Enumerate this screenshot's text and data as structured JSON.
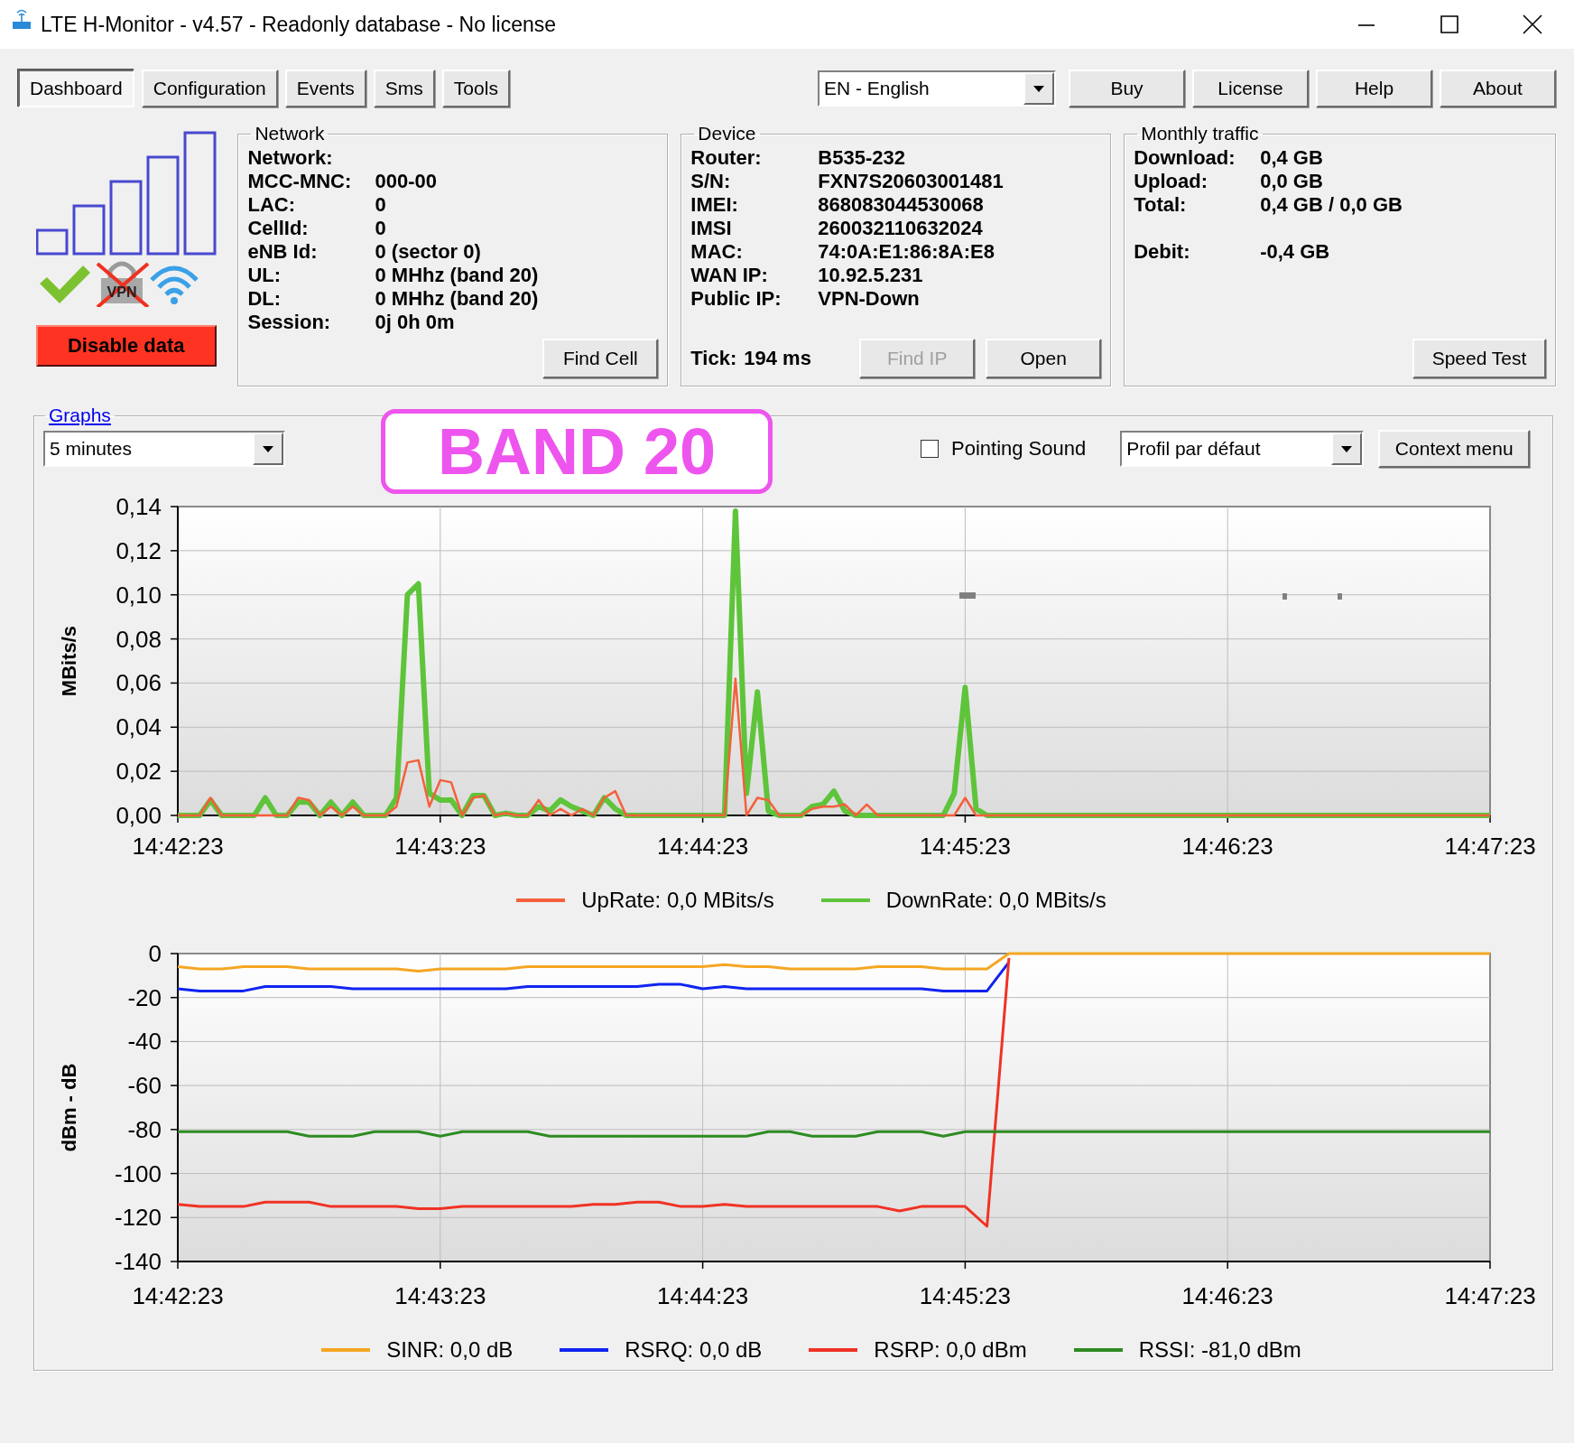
{
  "window": {
    "title": "LTE H-Monitor - v4.57 - Readonly database - No license"
  },
  "tabs": [
    {
      "label": "Dashboard",
      "selected": true
    },
    {
      "label": "Configuration",
      "selected": false
    },
    {
      "label": "Events",
      "selected": false
    },
    {
      "label": "Sms",
      "selected": false
    },
    {
      "label": "Tools",
      "selected": false
    }
  ],
  "language": {
    "value": "EN - English"
  },
  "top_buttons": [
    "Buy",
    "License",
    "Help",
    "About"
  ],
  "status": {
    "connected": true,
    "vpn": false,
    "vpn_label": "VPN",
    "disable_data_button": "Disable data"
  },
  "network": {
    "title": "Network",
    "rows": [
      {
        "label": "Network:"
      },
      {
        "label": "MCC-MNC:",
        "value": "000-00"
      },
      {
        "label": "LAC:",
        "value": "0"
      },
      {
        "label": "CellId:",
        "value": "0"
      },
      {
        "label": "eNB Id:",
        "value": "0 (sector 0)"
      },
      {
        "label": "UL:",
        "value": "0 MHhz (band 20)"
      },
      {
        "label": "DL:",
        "value": "0 MHhz (band 20)"
      },
      {
        "label": "Session:",
        "value": "0j 0h 0m"
      }
    ],
    "find_cell_button": "Find Cell"
  },
  "device": {
    "title": "Device",
    "rows": [
      {
        "label": "Router:",
        "value": "B535-232"
      },
      {
        "label": "S/N:",
        "value": "FXN7S20603001481"
      },
      {
        "label": "IMEI:",
        "value": "868083044530068"
      },
      {
        "label": "IMSI",
        "value": "260032110632024"
      },
      {
        "label": "MAC:",
        "value": "74:0A:E1:86:8A:E8"
      },
      {
        "label": "WAN IP:",
        "value": "10.92.5.231"
      },
      {
        "label": "Public IP:",
        "value": "VPN-Down"
      }
    ],
    "tick": {
      "label": "Tick:",
      "value": "194 ms"
    },
    "buttons": [
      {
        "label": "Find IP",
        "disabled": true
      },
      {
        "label": "Open",
        "disabled": false
      }
    ]
  },
  "monthly_traffic": {
    "title": "Monthly traffic",
    "rows": [
      {
        "label": "Download:",
        "value": "0,4 GB"
      },
      {
        "label": "Upload:",
        "value": "0,0 GB"
      },
      {
        "label": "Total:",
        "value": "0,4 GB / 0,0 GB"
      }
    ],
    "balance": {
      "label": "Debit:",
      "value": "-0,4 GB"
    },
    "speed_test_button": "Speed Test"
  },
  "graphs": {
    "title": "Graphs",
    "period": {
      "value": "5 minutes"
    },
    "band_badge": "BAND 20",
    "pointing_sound": {
      "label": "Pointing Sound",
      "checked": false
    },
    "profile": {
      "value": "Profil par défaut"
    },
    "context_menu_button": "Context menu",
    "throughput_chart": {
      "chart_data": {
        "type": "line",
        "grid": true,
        "legend": "bottom",
        "ylabel": "MBits/s",
        "ylim": [
          0,
          0.14
        ],
        "yticks": [
          {
            "value": 0,
            "label": "0,00"
          },
          {
            "value": 0.02,
            "label": "0,02"
          },
          {
            "value": 0.04,
            "label": "0,04"
          },
          {
            "value": 0.06,
            "label": "0,06"
          },
          {
            "value": 0.08,
            "label": "0,08"
          },
          {
            "value": 0.1,
            "label": "0,10"
          },
          {
            "value": 0.12,
            "label": "0,12"
          },
          {
            "value": 0.14,
            "label": "0,14"
          }
        ],
        "categories": [
          "14:42:23",
          null,
          null,
          null,
          null,
          null,
          null,
          null,
          null,
          null,
          null,
          null,
          null,
          null,
          null,
          null,
          null,
          null,
          null,
          null,
          null,
          null,
          null,
          null,
          "14:43:23",
          null,
          null,
          null,
          null,
          null,
          null,
          null,
          null,
          null,
          null,
          null,
          null,
          null,
          null,
          null,
          null,
          null,
          null,
          null,
          null,
          null,
          null,
          null,
          "14:44:23",
          null,
          null,
          null,
          null,
          null,
          null,
          null,
          null,
          null,
          null,
          null,
          null,
          null,
          null,
          null,
          null,
          null,
          null,
          null,
          null,
          null,
          null,
          null,
          "14:45:23",
          null,
          null,
          null,
          null,
          null,
          null,
          null,
          null,
          null,
          null,
          null,
          null,
          null,
          null,
          null,
          null,
          null,
          null,
          null,
          null,
          null,
          null,
          null,
          "14:46:23",
          null,
          null,
          null,
          null,
          null,
          null,
          null,
          null,
          null,
          null,
          null,
          null,
          null,
          null,
          null,
          null,
          null,
          null,
          null,
          null,
          null,
          null,
          null,
          "14:47:23"
        ],
        "series": [
          {
            "name": "UpRate: 0,0 MBits/s",
            "color": "#f4603c",
            "values": [
              0,
              0,
              0,
              0.008,
              0,
              0,
              0,
              0,
              0,
              0,
              0,
              0.008,
              0.007,
              0,
              0.004,
              0,
              0.004,
              0,
              0,
              0,
              0.004,
              0.024,
              0.025,
              0.004,
              0.016,
              0.015,
              0,
              0.008,
              0.009,
              0,
              0.001,
              0,
              0,
              0.007,
              0,
              0.003,
              0,
              0.003,
              0,
              0.008,
              0.011,
              0,
              0,
              0,
              0,
              0,
              0,
              0,
              0,
              0,
              0,
              0.062,
              0,
              0.008,
              0.007,
              0,
              0,
              0,
              0.003,
              0.004,
              0.004,
              0.005,
              0,
              0.005,
              0,
              0,
              0,
              0,
              0,
              0,
              0,
              0,
              0.008,
              0,
              0,
              0,
              0,
              0,
              0,
              0,
              0,
              0,
              0,
              0,
              0,
              0,
              0,
              0,
              0,
              0,
              0,
              0,
              0,
              0,
              0,
              0,
              0,
              0,
              0,
              0,
              0,
              0,
              0,
              0,
              0,
              0,
              0,
              0,
              0,
              0,
              0,
              0,
              0,
              0,
              0,
              0,
              0,
              0,
              0,
              0,
              0
            ]
          },
          {
            "name": "DownRate: 0,0 MBits/s",
            "color": "#5ec43a",
            "values": [
              0,
              0,
              0,
              0.007,
              0,
              0,
              0,
              0,
              0.008,
              0,
              0,
              0.006,
              0.006,
              0,
              0.006,
              0,
              0.006,
              0,
              0,
              0,
              0.008,
              0.1,
              0.105,
              0.01,
              0.007,
              0.007,
              0,
              0.009,
              0.009,
              0,
              0.001,
              0,
              0,
              0.004,
              0.002,
              0.007,
              0.004,
              0.002,
              0,
              0.008,
              0.003,
              0,
              0,
              0,
              0,
              0,
              0,
              0,
              0,
              0,
              0,
              0.138,
              0.01,
              0.056,
              0.002,
              0,
              0,
              0,
              0.004,
              0.005,
              0.011,
              0.002,
              0,
              0,
              0,
              0,
              0,
              0,
              0,
              0,
              0,
              0.01,
              0.058,
              0.003,
              0,
              0,
              0,
              0,
              0,
              0,
              0,
              0,
              0,
              0,
              0,
              0,
              0,
              0,
              0,
              0,
              0,
              0,
              0,
              0,
              0,
              0,
              0,
              0,
              0,
              0,
              0,
              0,
              0,
              0,
              0,
              0,
              0,
              0,
              0,
              0,
              0,
              0,
              0,
              0,
              0,
              0,
              0,
              0,
              0,
              0,
              0
            ]
          }
        ]
      }
    },
    "signal_chart": {
      "chart_data": {
        "type": "line",
        "grid": true,
        "legend": "bottom",
        "ylabel": "dBm - dB",
        "ylim": [
          -140,
          0
        ],
        "yticks": [
          -140,
          -120,
          -100,
          -80,
          -60,
          -40,
          -20,
          0
        ],
        "categories": [
          "14:42:23",
          null,
          null,
          null,
          null,
          null,
          null,
          null,
          null,
          null,
          null,
          null,
          "14:43:23",
          null,
          null,
          null,
          null,
          null,
          null,
          null,
          null,
          null,
          null,
          null,
          "14:44:23",
          null,
          null,
          null,
          null,
          null,
          null,
          null,
          null,
          null,
          null,
          null,
          "14:45:23",
          null,
          null,
          null,
          null,
          null,
          null,
          null,
          null,
          null,
          null,
          null,
          "14:46:23",
          null,
          null,
          null,
          null,
          null,
          null,
          null,
          null,
          null,
          null,
          null,
          "14:47:23"
        ],
        "series": [
          {
            "name": "SINR: 0,0 dB",
            "color": "#f5a623",
            "values": [
              -6,
              -7,
              -7,
              -6,
              -6,
              -6,
              -7,
              -7,
              -7,
              -7,
              -7,
              -8,
              -7,
              -7,
              -7,
              -7,
              -6,
              -6,
              -6,
              -6,
              -6,
              -6,
              -6,
              -6,
              -6,
              -5,
              -6,
              -6,
              -7,
              -7,
              -7,
              -7,
              -6,
              -6,
              -6,
              -7,
              -7,
              -7,
              0,
              0,
              0,
              0,
              0,
              0,
              0,
              0,
              0,
              0,
              0,
              0,
              0,
              0,
              0,
              0,
              0,
              0,
              0,
              0,
              0,
              0,
              0
            ]
          },
          {
            "name": "RSRQ: 0,0 dB",
            "color": "#1024f0",
            "values": [
              -16,
              -17,
              -17,
              -17,
              -15,
              -15,
              -15,
              -15,
              -16,
              -16,
              -16,
              -16,
              -16,
              -16,
              -16,
              -16,
              -15,
              -15,
              -15,
              -15,
              -15,
              -15,
              -14,
              -14,
              -16,
              -15,
              -16,
              -16,
              -16,
              -16,
              -16,
              -16,
              -16,
              -16,
              -16,
              -17,
              -17,
              -17,
              -4,
              null,
              null,
              null,
              null,
              null,
              null,
              null,
              null,
              null,
              null,
              null,
              null,
              null,
              null,
              null,
              null,
              null,
              null,
              null,
              null,
              null,
              null
            ]
          },
          {
            "name": "RSRP: 0,0 dBm",
            "color": "#f03224",
            "values": [
              -114,
              -115,
              -115,
              -115,
              -113,
              -113,
              -113,
              -115,
              -115,
              -115,
              -115,
              -116,
              -116,
              -115,
              -115,
              -115,
              -115,
              -115,
              -115,
              -114,
              -114,
              -113,
              -113,
              -115,
              -115,
              -114,
              -115,
              -115,
              -115,
              -115,
              -115,
              -115,
              -115,
              -117,
              -115,
              -115,
              -115,
              -124,
              -2,
              null,
              null,
              null,
              null,
              null,
              null,
              null,
              null,
              null,
              null,
              null,
              null,
              null,
              null,
              null,
              null,
              null,
              null,
              null,
              null,
              null,
              null
            ]
          },
          {
            "name": "RSSI: -81,0 dBm",
            "color": "#2e8b22",
            "values": [
              -81,
              -81,
              -81,
              -81,
              -81,
              -81,
              -83,
              -83,
              -83,
              -81,
              -81,
              -81,
              -83,
              -81,
              -81,
              -81,
              -81,
              -83,
              -83,
              -83,
              -83,
              -83,
              -83,
              -83,
              -83,
              -83,
              -83,
              -81,
              -81,
              -83,
              -83,
              -83,
              -81,
              -81,
              -81,
              -83,
              -81,
              -81,
              -81,
              -81,
              -81,
              -81,
              -81,
              -81,
              -81,
              -81,
              -81,
              -81,
              -81,
              -81,
              -81,
              -81,
              -81,
              -81,
              -81,
              -81,
              -81,
              -81,
              -81,
              -81,
              -81
            ]
          }
        ]
      }
    }
  }
}
